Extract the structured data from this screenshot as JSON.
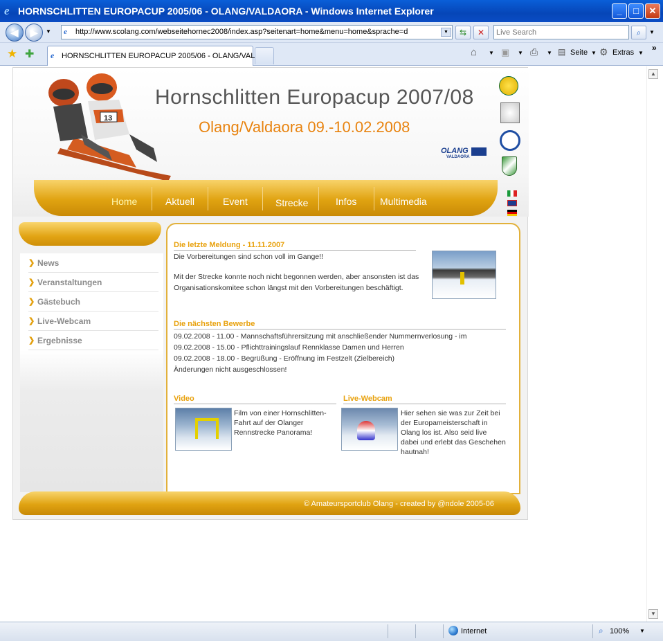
{
  "window": {
    "title": "HORNSCHLITTEN EUROPACUP 2005/06 - OLANG/VALDAORA - Windows Internet Explorer",
    "min_label": "_",
    "max_label": "□",
    "close_label": "✕"
  },
  "address_bar": {
    "url": "http://www.scolang.com/webseitehornec2008/index.asp?seitenart=home&menu=home&sprache=d",
    "search_placeholder": "Live Search"
  },
  "tab": {
    "title": "HORNSCHLITTEN EUROPACUP 2005/06 - OLANG/VAL..."
  },
  "toolbar": {
    "page_label": "Seite",
    "tools_label": "Extras",
    "more_label": "»"
  },
  "site": {
    "title": "Hornschlitten Europacup 2007/08",
    "subtitle": "Olang/Valdaora 09.-10.02.2008",
    "sponsor_logo_text": "OLANG",
    "sponsor_logo_sub": "VALDAORA",
    "bib_number": "13",
    "nav": [
      "Home",
      "Aktuell",
      "Event",
      "Strecke",
      "Infos",
      "Multimedia"
    ],
    "sidebar": [
      "News",
      "Veranstaltungen",
      "Gästebuch",
      "Live-Webcam",
      "Ergebnisse"
    ],
    "latest_news": {
      "heading": "Die letzte Meldung - 11.11.2007",
      "line1": "Die Vorbereitungen sind schon voll im Gange!!",
      "para2": "Mit der Strecke konnte noch nicht begonnen werden, aber ansonsten ist das Organisationskomitee schon längst mit den Vorbereitungen beschäftigt."
    },
    "next_races": {
      "heading": "Die nächsten Bewerbe",
      "lines": [
        "09.02.2008 - 11.00 - Mannschaftsführersitzung mit anschließender Nummernverlosung - im",
        "09.02.2008 - 15.00 - Pflichttrainingslauf Rennklasse Damen und Herren",
        "09.02.2008 - 18.00 - Begrüßung - Eröffnung im Festzelt (Zielbereich)",
        "Änderungen nicht ausgeschlossen!"
      ]
    },
    "video": {
      "heading": "Video",
      "text": "Film von einer Hornschlitten-Fahrt auf der Olanger Rennstrecke Panorama!"
    },
    "webcam": {
      "heading": "Live-Webcam",
      "text": "Hier sehen sie was zur Zeit bei der Europameisterschaft in Olang los ist. Also seid live dabei und erlebt das Geschehen hautnah!"
    },
    "footer": "© Amateursportclub Olang - created by @ndole 2005-06"
  },
  "status": {
    "zone": "Internet",
    "zoom": "100%"
  },
  "colors": {
    "accent_gold": "#e0a312",
    "heading_orange": "#e8830f",
    "ie_blue": "#0646b8"
  }
}
